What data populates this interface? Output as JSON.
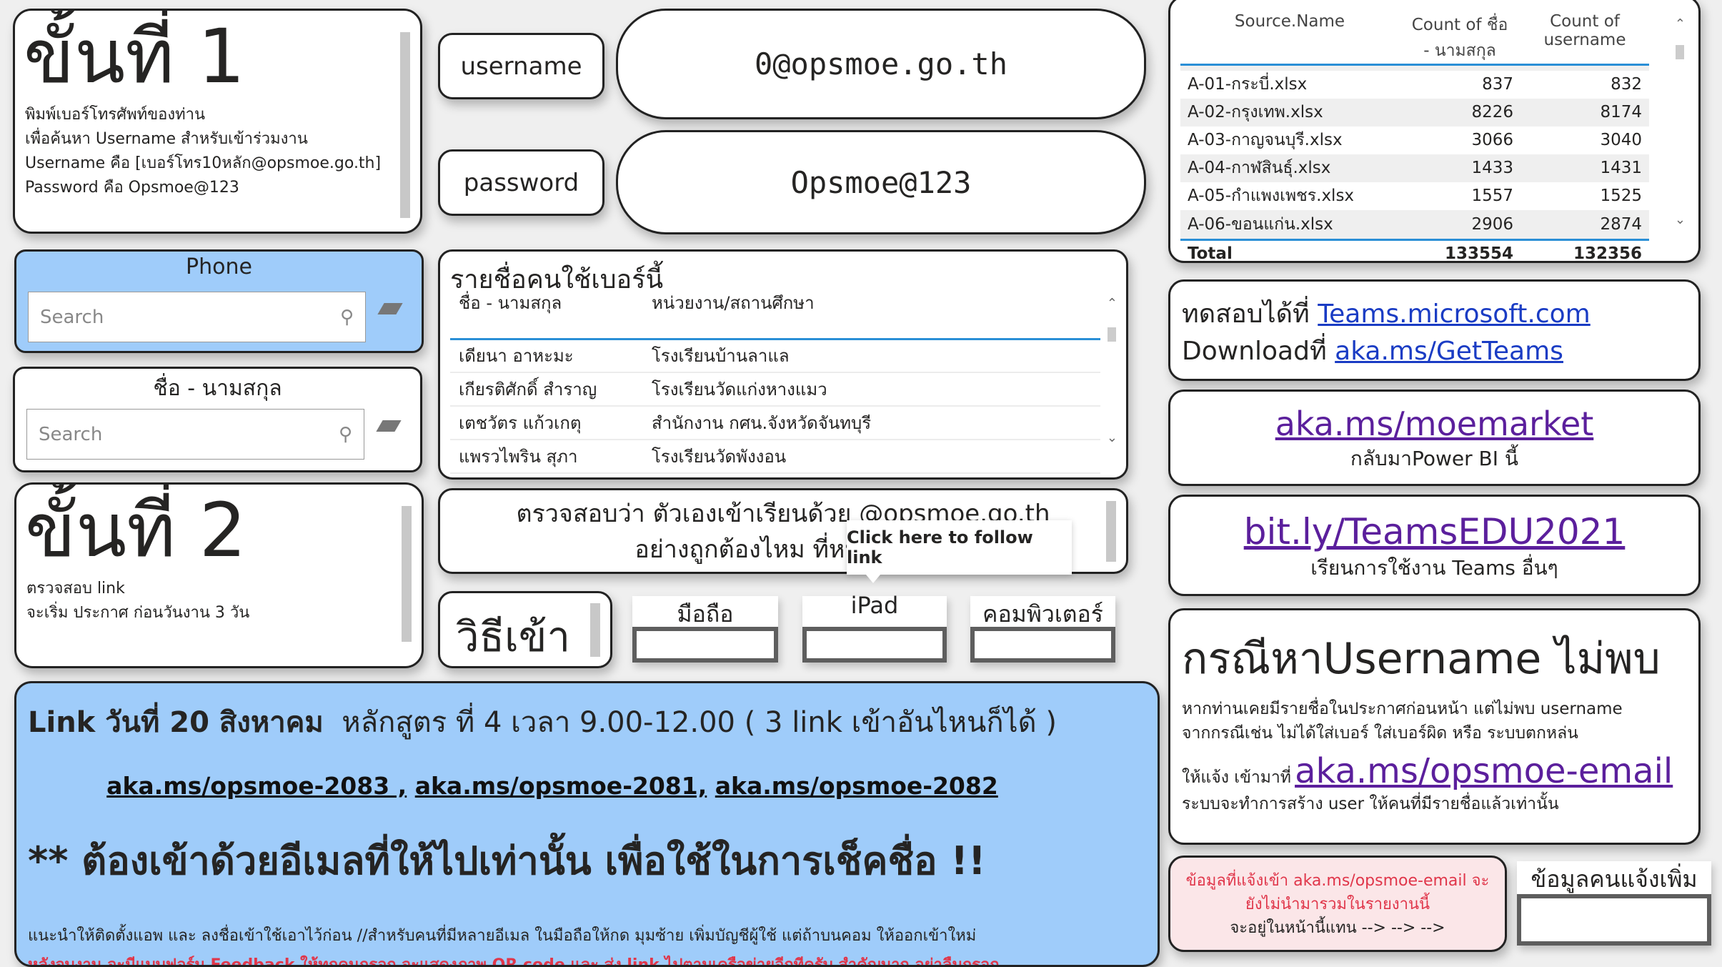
{
  "step1": {
    "title": "ขั้นที่ 1",
    "lines": [
      "พิมพ์เบอร์โทรศัพท์ของท่าน",
      "เพื่อค้นหา Username สำหรับเข้าร่วมงาน",
      "Username คือ [เบอร์โทร10หลัก@opsmoe.go.th]",
      "Password คือ Opsmoe@123"
    ]
  },
  "credentials": {
    "username_label": "username",
    "username_value": "0@opsmoe.go.th",
    "password_label": "password",
    "password_value": "Opsmoe@123"
  },
  "phone_slicer": {
    "title": "Phone",
    "placeholder": "Search"
  },
  "name_slicer": {
    "title": "ชื่อ - นามสกุล",
    "placeholder": "Search"
  },
  "step2": {
    "title": "ขั้นที่ 2",
    "lines": [
      "ตรวจสอบ link",
      "จะเริ่ม ประกาศ ก่อนวันงาน 3 วัน"
    ]
  },
  "people_list": {
    "title": "รายชื่อคนใช้เบอร์นี้",
    "columns": [
      "ชื่อ - นามสกุล",
      "หน่วยงาน/สถานศึกษา"
    ],
    "rows": [
      [
        "เดียนา อาหะมะ",
        "โรงเรียนบ้านลาแล"
      ],
      [
        "เกียรติศักดิ์ สำราญ",
        "โรงเรียนวัดแก่งหางแมว"
      ],
      [
        "เตชวัตร แก้วเกตุ",
        "สำนักงาน กศน.จังหวัดจันทบุรี"
      ],
      [
        "แพรวไพริน สุภา",
        "โรงเรียนวัดพังงอน"
      ]
    ]
  },
  "check_box": {
    "line1": "ตรวจสอบว่า ตัวเองเข้าเรียนด้วย @opsmoe.go.th",
    "line2": "อย่างถูกต้องไหม ที่หน้า 4 ( เ"
  },
  "tooltip": "Click here to follow link",
  "methods": {
    "title": "วิธีเข้า",
    "options": [
      "มือถือ",
      "iPad",
      "คอมพิวเตอร์"
    ]
  },
  "links_panel": {
    "heading_bold": "Link วันที่ 20 สิงหาคม",
    "heading_rest": "หลักสูตร ที่ 4 เวลา 9.00-12.00 ( 3 link เข้าอันไหนก็ได้ )",
    "links": [
      "aka.ms/opsmoe-2083 ,",
      "aka.ms/opsmoe-2081,",
      "aka.ms/opsmoe-2082"
    ],
    "warning": "** ต้องเข้าด้วยอีเมลที่ให้ไปเท่านั้น เพื่อใช้ในการเช็คชื่อ !!",
    "note": "แนะนำให้ติดตั้งแอพ และ ลงชื่อเข้าใช้เอาไว้ก่อน  //สำหรับคนที่มีหลายอีเมล ในมือถือให้กด มุมซ้าย เพิ่มบัญชีผู้ใช้ แต่ถ้าบนคอม ให้ออกเข้าใหม่",
    "feedback": "หลังจบงาน จะมีแบบฟอร์ม Feedback ให้ทุกคนกรอก จะแสดงภาพ QR code และ ส่ง link ไปตามเครือข่ายอีกทีครับ สำคัญมาก อย่าลืมกรอก"
  },
  "source_table": {
    "columns": [
      "Source.Name",
      "Count of ชื่อ - นามสกุล",
      "Count of username"
    ],
    "rows": [
      [
        "A-01-กระบี่.xlsx",
        "837",
        "832"
      ],
      [
        "A-02-กรุงเทพ.xlsx",
        "8226",
        "8174"
      ],
      [
        "A-03-กาญจนบุรี.xlsx",
        "3066",
        "3040"
      ],
      [
        "A-04-กาฬสินธุ์.xlsx",
        "1433",
        "1431"
      ],
      [
        "A-05-กำแพงเพชร.xlsx",
        "1557",
        "1525"
      ],
      [
        "A-06-ขอนแก่น.xlsx",
        "2906",
        "2874"
      ]
    ],
    "total": [
      "Total",
      "133554",
      "132356"
    ]
  },
  "teams": {
    "try_label": "ทดสอบได้ที่",
    "try_link": "Teams.microsoft.com",
    "download_label": "Downloadที่",
    "download_link": "aka.ms/GetTeams"
  },
  "moemarket": {
    "link": "aka.ms/moemarket",
    "sub": "กลับมาPower BI  นี้"
  },
  "teamsedu": {
    "link": "bit.ly/TeamsEDU2021",
    "sub": "เรียนการใช้งาน Teams อื่นๆ"
  },
  "not_found": {
    "title": "กรณีหาUsername ไม่พบ",
    "line1": "หากท่านเคยมีรายชื่อในประกาศก่อนหน้า แต่ไม่พบ username",
    "line2": "จากกรณีเช่น ไม่ได้ใส่เบอร์ ใส่เบอร์ผิด หรือ ระบบตกหล่น",
    "report_label": "ให้แจ้ง เข้ามาที่",
    "report_link": "aka.ms/opsmoe-email",
    "line3": "ระบบจะทำการสร้าง user ให้คนที่มีรายชื่อแล้วเท่านั้น"
  },
  "pink_note": {
    "line1": "ข้อมูลที่แจ้งเข้า aka.ms/opsmoe-email จะ",
    "line2": "ยังไม่นำมารวมในรายงานนี้",
    "line3": "จะอยู่ในหน้านี้แทน --> --> -->"
  },
  "extra": {
    "title": "ข้อมูลคนแจ้งเพิ่ม"
  },
  "colors": {
    "slicer_blue": "#9fccfa",
    "pink": "#fbe6e8",
    "red_text": "#e0364a",
    "link_blue": "#1a3cc4",
    "link_purple": "#5b1f9c",
    "accent_line": "#2a8fd6"
  }
}
